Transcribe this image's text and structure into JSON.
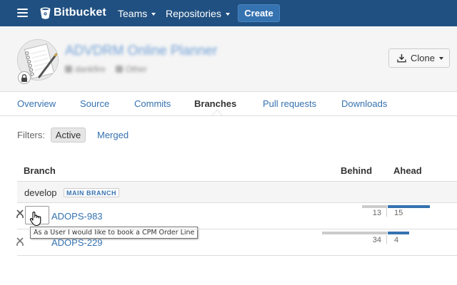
{
  "topbar": {
    "logo_text": "Bitbucket",
    "teams_label": "Teams",
    "repositories_label": "Repositories",
    "create_label": "Create"
  },
  "repo": {
    "title": "ADVDRM Online Planner",
    "owner": "dankfire",
    "language": "Other",
    "clone_label": "Clone"
  },
  "tabs": [
    {
      "label": "Overview"
    },
    {
      "label": "Source"
    },
    {
      "label": "Commits"
    },
    {
      "label": "Branches"
    },
    {
      "label": "Pull requests"
    },
    {
      "label": "Downloads"
    }
  ],
  "filters": {
    "label": "Filters:",
    "active_label": "Active",
    "merged_label": "Merged"
  },
  "table": {
    "col_branch": "Branch",
    "col_behind": "Behind",
    "col_ahead": "Ahead",
    "main_branch": {
      "name": "develop",
      "badge": "MAIN BRANCH"
    },
    "rows": [
      {
        "name": "ADOPS-983",
        "behind": "13",
        "ahead": "15",
        "behind_fraction": 0.27,
        "ahead_fraction": 0.45
      },
      {
        "name": "ADOPS-229",
        "behind": "34",
        "ahead": "4",
        "behind_fraction": 0.7,
        "ahead_fraction": 0.23
      }
    ]
  },
  "tooltip": {
    "text": "As a User I would like to book a CPM Order Line"
  },
  "colors": {
    "nav_bg": "#205081",
    "link": "#3572b0",
    "ahead_bar": "#3572b0",
    "behind_bar": "#cccccc"
  }
}
